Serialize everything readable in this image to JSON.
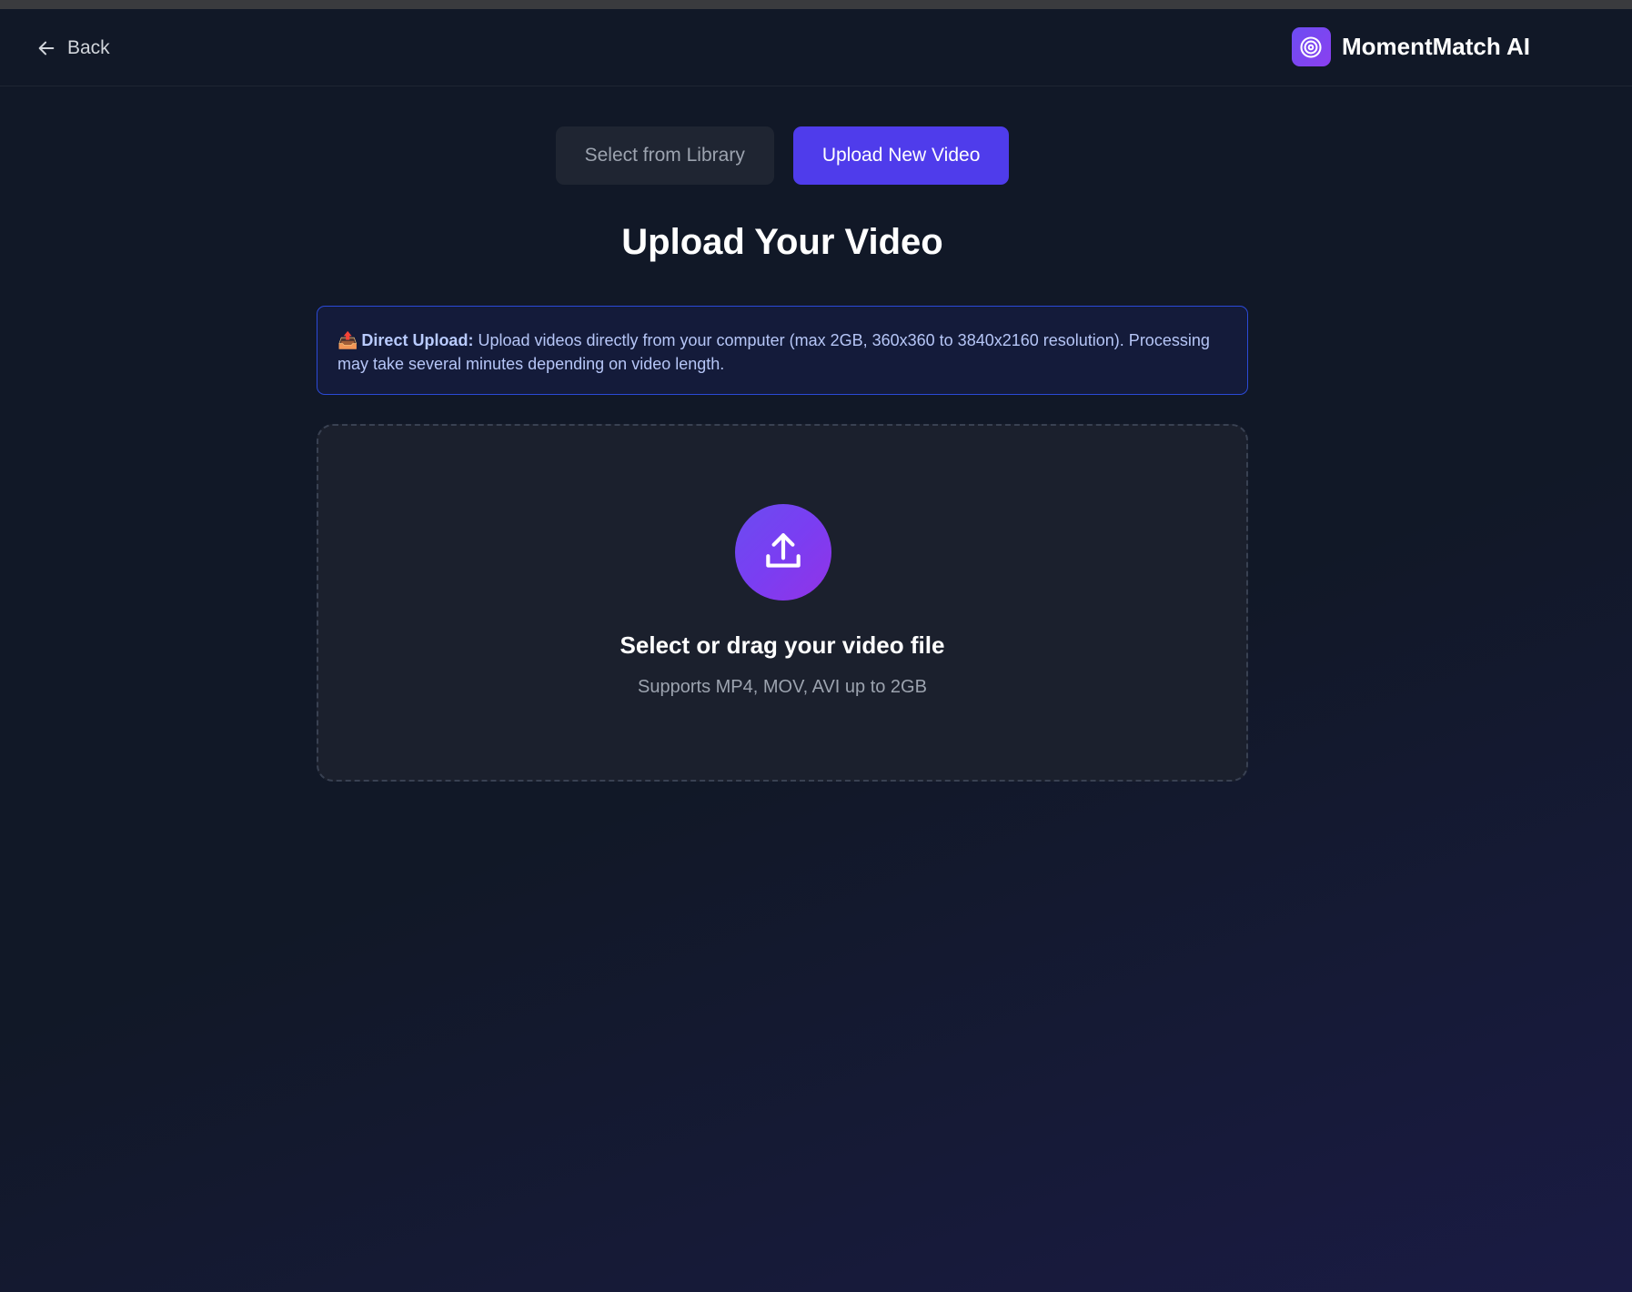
{
  "header": {
    "back_label": "Back",
    "brand_name": "MomentMatch AI",
    "brand_icon": "target-icon"
  },
  "tabs": [
    {
      "label": "Select from Library",
      "active": false
    },
    {
      "label": "Upload New Video",
      "active": true
    }
  ],
  "page_title": "Upload Your Video",
  "notice": {
    "emoji": "📤",
    "strong": "Direct Upload:",
    "text": " Upload videos directly from your computer (max 2GB, 360x360 to 3840x2160 resolution). Processing may take several minutes depending on video length."
  },
  "dropzone": {
    "icon": "upload-icon",
    "title": "Select or drag your video file",
    "subtitle": "Supports MP4, MOV, AVI up to 2GB"
  },
  "colors": {
    "background": "#111827",
    "accent": "#4f3ceb",
    "brand_gradient_start": "#6d4df2",
    "brand_gradient_end": "#8b3ff0",
    "notice_border": "#2b4ad6"
  }
}
